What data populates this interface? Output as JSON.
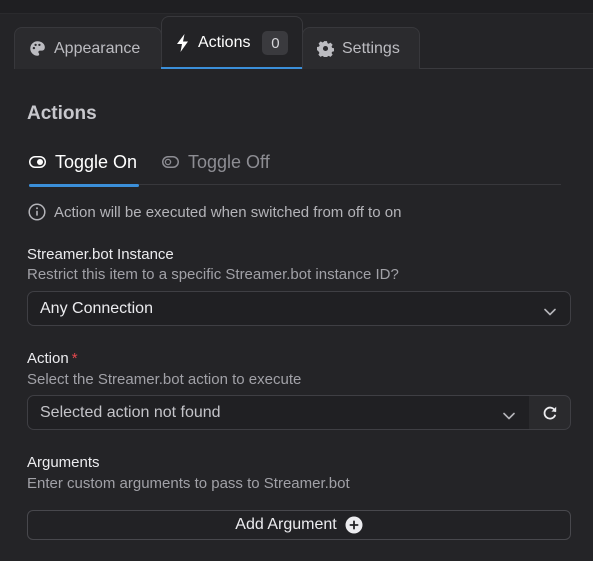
{
  "tabs": [
    {
      "label": "Appearance",
      "icon": "palette-icon"
    },
    {
      "label": "Actions",
      "icon": "lightning-icon",
      "count": "0"
    },
    {
      "label": "Settings",
      "icon": "gear-icon"
    }
  ],
  "section_title": "Actions",
  "subtabs": [
    {
      "label": "Toggle On",
      "icon": "toggle-on-icon",
      "active": true
    },
    {
      "label": "Toggle Off",
      "icon": "toggle-off-icon",
      "active": false
    }
  ],
  "info_text": "Action will be executed when switched from off to on",
  "instance": {
    "label": "Streamer.bot Instance",
    "description": "Restrict this item to a specific Streamer.bot instance ID?",
    "value": "Any Connection"
  },
  "action": {
    "label": "Action",
    "required_mark": "*",
    "description": "Select the Streamer.bot action to execute",
    "value": "Selected action not found"
  },
  "arguments": {
    "label": "Arguments",
    "description": "Enter custom arguments to pass to Streamer.bot",
    "add_button": "Add Argument"
  },
  "colors": {
    "accent": "#3b8fd9",
    "background": "#242427",
    "required": "#e5484d"
  }
}
